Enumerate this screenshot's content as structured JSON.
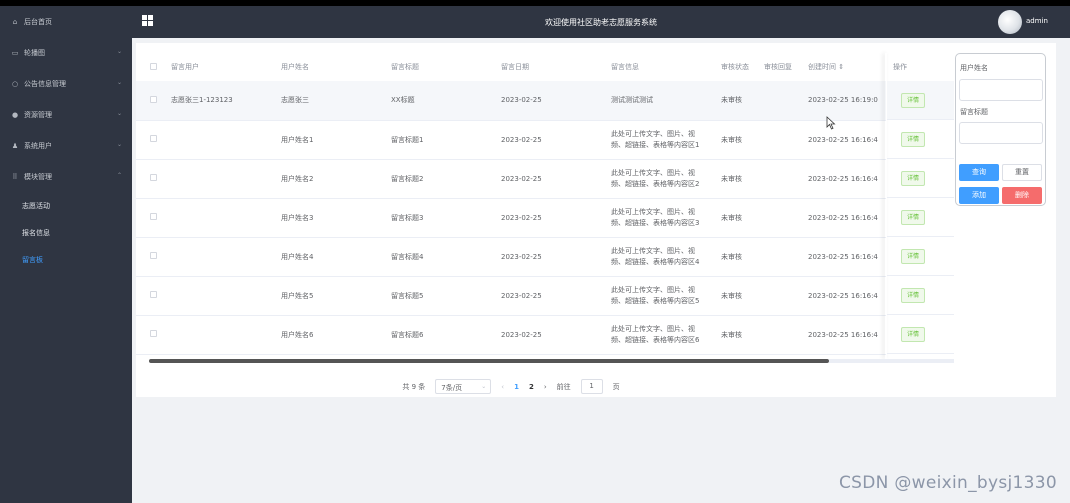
{
  "header": {
    "title": "欢迎使用社区助老志愿服务系统",
    "user": "admin"
  },
  "sidebar": {
    "items": [
      {
        "label": "后台首页",
        "icon": "home-icon"
      },
      {
        "label": "轮播图",
        "icon": "image-icon"
      },
      {
        "label": "公告信息管理",
        "icon": "notice-icon"
      },
      {
        "label": "资源管理",
        "icon": "resource-icon"
      },
      {
        "label": "系统用户",
        "icon": "user-icon"
      },
      {
        "label": "模块管理",
        "icon": "module-icon"
      }
    ],
    "sub_items": [
      {
        "label": "志愿活动"
      },
      {
        "label": "报名信息"
      },
      {
        "label": "留言板"
      }
    ]
  },
  "table": {
    "columns": [
      "留言用户",
      "用户姓名",
      "留言标题",
      "留言日期",
      "留言信息",
      "审核状态",
      "审核回复",
      "创建时间 ⇕",
      "操作"
    ],
    "rows": [
      {
        "user": "志愿张三1-123123",
        "name": "志愿张三",
        "title": "XX标题",
        "date": "2023-02-25",
        "info_line1": "测试测试测试",
        "info_line2": "",
        "status": "未审核",
        "reply": "",
        "created": "2023-02-25 16:19:0",
        "action": "详情"
      },
      {
        "user": "",
        "name": "用户姓名1",
        "title": "留言标题1",
        "date": "2023-02-25",
        "info_line1": "此处可上传文字、图片、视",
        "info_line2": "频、超链接、表格等内容区1",
        "status": "未审核",
        "reply": "",
        "created": "2023-02-25 16:16:4",
        "action": "详情"
      },
      {
        "user": "",
        "name": "用户姓名2",
        "title": "留言标题2",
        "date": "2023-02-25",
        "info_line1": "此处可上传文字、图片、视",
        "info_line2": "频、超链接、表格等内容区2",
        "status": "未审核",
        "reply": "",
        "created": "2023-02-25 16:16:4",
        "action": "详情"
      },
      {
        "user": "",
        "name": "用户姓名3",
        "title": "留言标题3",
        "date": "2023-02-25",
        "info_line1": "此处可上传文字、图片、视",
        "info_line2": "频、超链接、表格等内容区3",
        "status": "未审核",
        "reply": "",
        "created": "2023-02-25 16:16:4",
        "action": "详情"
      },
      {
        "user": "",
        "name": "用户姓名4",
        "title": "留言标题4",
        "date": "2023-02-25",
        "info_line1": "此处可上传文字、图片、视",
        "info_line2": "频、超链接、表格等内容区4",
        "status": "未审核",
        "reply": "",
        "created": "2023-02-25 16:16:4",
        "action": "详情"
      },
      {
        "user": "",
        "name": "用户姓名5",
        "title": "留言标题5",
        "date": "2023-02-25",
        "info_line1": "此处可上传文字、图片、视",
        "info_line2": "频、超链接、表格等内容区5",
        "status": "未审核",
        "reply": "",
        "created": "2023-02-25 16:16:4",
        "action": "详情"
      },
      {
        "user": "",
        "name": "用户姓名6",
        "title": "留言标题6",
        "date": "2023-02-25",
        "info_line1": "此处可上传文字、图片、视",
        "info_line2": "频、超链接、表格等内容区6",
        "status": "未审核",
        "reply": "",
        "created": "2023-02-25 16:16:4",
        "action": "详情"
      }
    ]
  },
  "pager": {
    "total": "共 9 条",
    "page_size": "7条/页",
    "prev": "‹",
    "pages": [
      "1",
      "2"
    ],
    "next": "›",
    "goto_prefix": "前往",
    "goto_value": "1",
    "goto_suffix": "页"
  },
  "search": {
    "name_label": "用户姓名",
    "title_label": "留言标题",
    "query": "查询",
    "reset": "重置",
    "add": "添加",
    "delete": "删除"
  },
  "watermark": "CSDN @weixin_bysj1330",
  "colors": {
    "sidebar_bg": "#2f3542",
    "primary": "#409eff",
    "danger": "#f56c6c",
    "success": "#67c23a"
  }
}
